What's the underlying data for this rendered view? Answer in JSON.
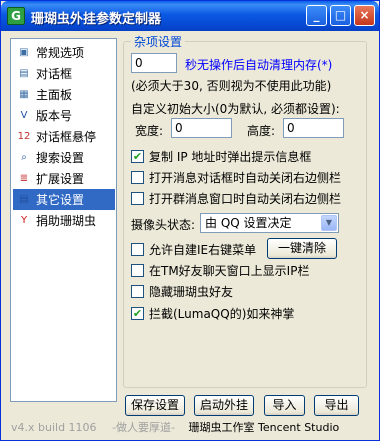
{
  "window": {
    "title": "珊瑚虫外挂参数定制器",
    "app_icon_letter": "G",
    "controls": {
      "minimize": "_",
      "maximize": "□",
      "close": "×"
    }
  },
  "nav": {
    "items": [
      {
        "label": "常规选项",
        "icon": "gear-window-icon",
        "glyph": "▣",
        "color": "#3a6ea5"
      },
      {
        "label": "对话框",
        "icon": "dialog-icon",
        "glyph": "▤",
        "color": "#3a6ea5"
      },
      {
        "label": "主面板",
        "icon": "panel-icon",
        "glyph": "▦",
        "color": "#3a6ea5"
      },
      {
        "label": "版本号",
        "icon": "version-icon",
        "glyph": "V",
        "color": "#1f4fa0"
      },
      {
        "label": "对话框悬停",
        "icon": "calendar-icon",
        "glyph": "12",
        "color": "#c03030"
      },
      {
        "label": "搜索设置",
        "icon": "magnifier-icon",
        "glyph": "⌕",
        "color": "#1f4fa0"
      },
      {
        "label": "扩展设置",
        "icon": "extension-icon",
        "glyph": "≣",
        "color": "#c03030"
      },
      {
        "label": "其它设置",
        "icon": "settings-icon",
        "glyph": "▤",
        "color": "#1f4fa0",
        "selected": true
      },
      {
        "label": "捐助珊瑚虫",
        "icon": "y-logo-icon",
        "glyph": "Y",
        "color": "#d01010"
      }
    ]
  },
  "group": {
    "title": "杂项设置",
    "auto_clear": {
      "value": "0",
      "label": "秒无操作后自动清理内存(*)"
    },
    "auto_clear_note": "(必须大于30, 否则视为不使用此功能)",
    "custom_size_label": "自定义初始大小(0为默认, 必须都设置):",
    "width_label": "宽度:",
    "width_value": "0",
    "height_label": "高度:",
    "height_value": "0",
    "checkboxes": [
      {
        "label": "复制 IP 地址时弹出提示信息框",
        "checked": true
      },
      {
        "label": "打开消息对话框时自动关闭右边侧栏",
        "checked": false
      },
      {
        "label": "打开群消息窗口时自动关闭右边侧栏",
        "checked": false
      }
    ],
    "camera_label": "摄像头状态:",
    "camera_value": "由 QQ 设置决定",
    "checkboxes2": [
      {
        "label": "允许自建IE右键菜单",
        "checked": false
      },
      {
        "label": "在TM好友聊天窗口上显示IP栏",
        "checked": false
      },
      {
        "label": "隐藏珊瑚虫好友",
        "checked": false
      },
      {
        "label": "拦截(LumaQQ的)如来神掌",
        "checked": true
      }
    ],
    "clear_button": "一键清除"
  },
  "buttons": {
    "save": "保存设置",
    "start": "启动外挂",
    "import": "导入",
    "export": "导出"
  },
  "status": {
    "version": "v4.x build 1106",
    "slogan": "-做人要厚道-",
    "studio": "珊瑚虫工作室 Tencent Studio"
  }
}
